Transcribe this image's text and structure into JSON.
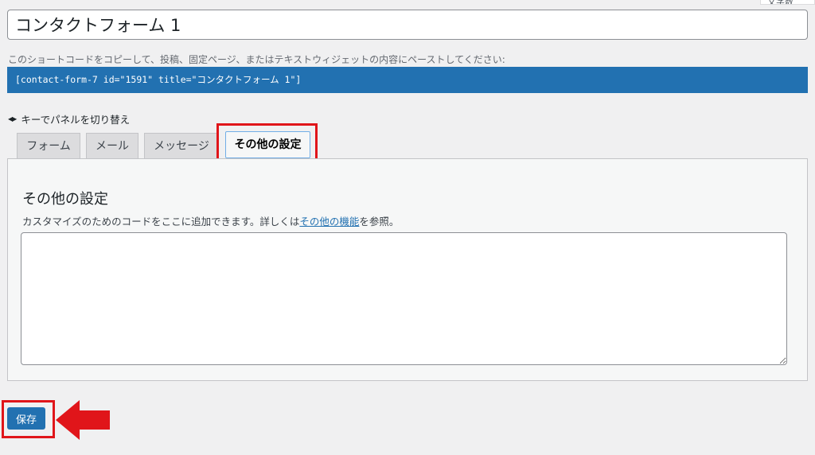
{
  "header": {
    "corner_label": "文字数"
  },
  "form": {
    "title_value": "コンタクトフォーム 1"
  },
  "shortcode": {
    "note": "このショートコードをコピーして、投稿、固定ページ、またはテキストウィジェットの内容にペーストしてください:",
    "code": "[contact-form-7 id=\"1591\" title=\"コンタクトフォーム 1\"]"
  },
  "keyhint": {
    "icon": "left-right-arrows-icon",
    "text": "キーでパネルを切り替え"
  },
  "tabs": [
    {
      "label": "フォーム",
      "active": false
    },
    {
      "label": "メール",
      "active": false
    },
    {
      "label": "メッセージ",
      "active": false
    },
    {
      "label": "その他の設定",
      "active": true
    }
  ],
  "panel": {
    "title": "その他の設定",
    "desc_before": "カスタマイズのためのコードをここに追加できます。詳しくは",
    "desc_link": "その他の機能",
    "desc_after": "を参照。",
    "textarea_value": ""
  },
  "actions": {
    "save_label": "保存"
  },
  "annotations": {
    "highlight_color": "#e0151a",
    "arrow_icon": "red-left-arrow-icon"
  },
  "colors": {
    "accent": "#2271b1",
    "background": "#f0f0f1"
  }
}
